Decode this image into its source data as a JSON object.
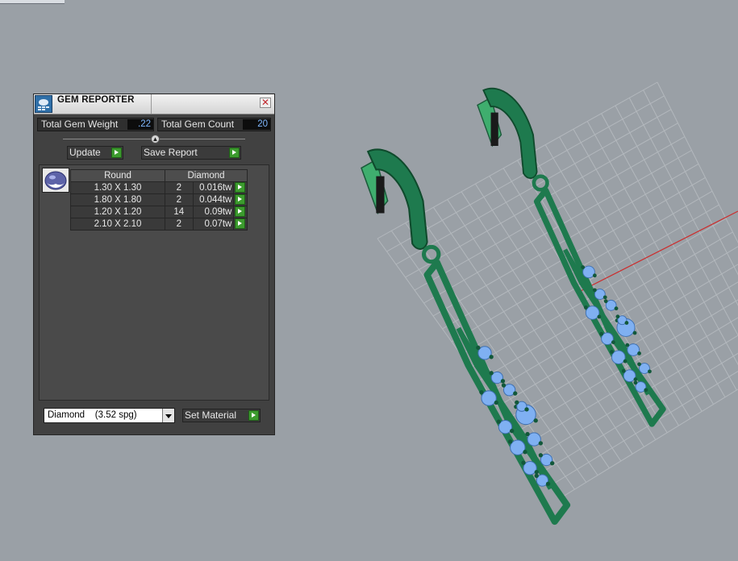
{
  "panel": {
    "title": "GEM REPORTER",
    "close_glyph": "✕",
    "total_weight_label": "Total Gem Weight",
    "total_weight_value": ".22",
    "total_count_label": "Total Gem Count",
    "total_count_value": "20",
    "update_label": "Update",
    "save_report_label": "Save Report",
    "table": {
      "headers": [
        "Round",
        "Diamond"
      ],
      "rows": [
        {
          "size": "1.30 X 1.30",
          "count": "2",
          "weight": "0.016tw"
        },
        {
          "size": "1.80 X 1.80",
          "count": "2",
          "weight": "0.044tw"
        },
        {
          "size": "1.20 X 1.20",
          "count": "14",
          "weight": "0.09tw"
        },
        {
          "size": "2.10 X 2.10",
          "count": "2",
          "weight": "0.07tw"
        }
      ]
    },
    "material_selected": "Diamond    (3.52 spg)",
    "set_material_label": "Set Material"
  },
  "icons": {
    "title": "gem-reporter-icon",
    "close": "close-icon",
    "go": "green-play-arrow-icon",
    "slider": "slider-knob-icon",
    "gem": "round-gem-icon",
    "dropdown": "chevron-down-icon"
  },
  "colors": {
    "viewport_bg": "#9aa0a6",
    "grid": "#b3b8bd",
    "axis_x": "#cc2d2d",
    "metal": "#1e7a4e",
    "metal_light": "#3fae6e",
    "gem": "#7fb0f2",
    "value_text": "#7fb8ff",
    "go_button": "#3c9b2e"
  }
}
